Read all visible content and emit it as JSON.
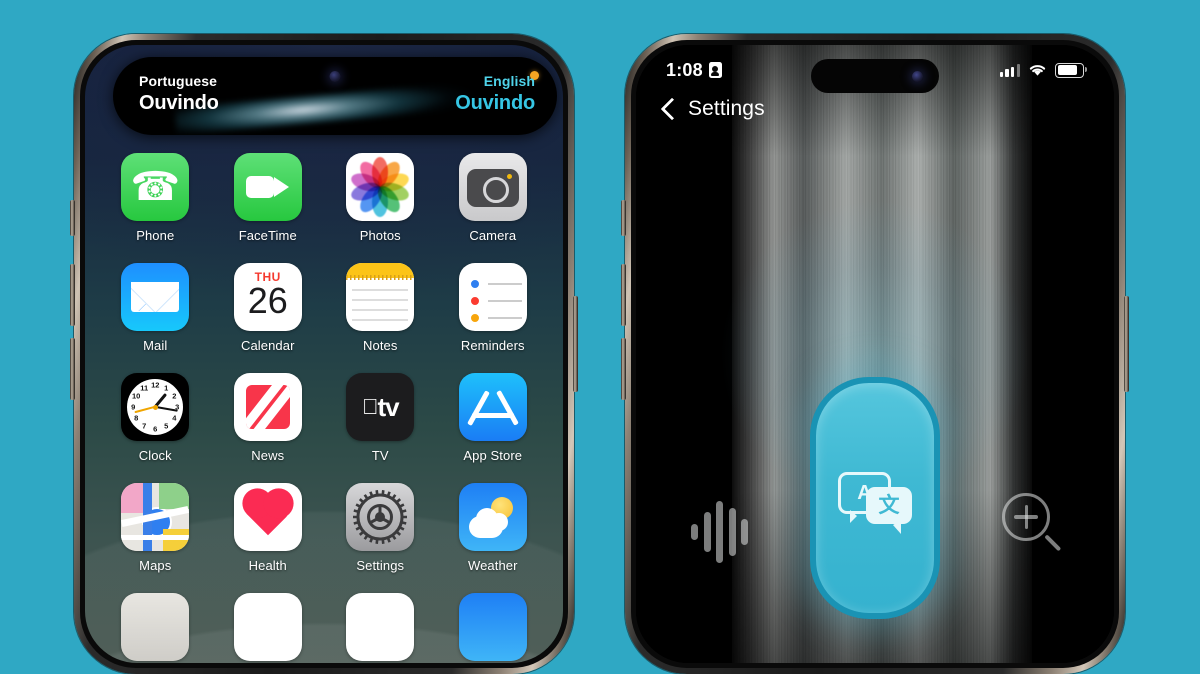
{
  "background_color": "#2FA8C4",
  "left_phone": {
    "name": "iphone-home-screen",
    "dynamic_island": {
      "name": "live-translation-banner",
      "source_language": "Portuguese",
      "source_text": "Ouvindo",
      "target_language": "English",
      "target_text": "Ouvindo",
      "mic_indicator": "orange-dot",
      "source_color": "#ffffff",
      "target_color": "#36c6e4"
    },
    "app_rows": [
      [
        {
          "label": "Phone",
          "icon": "phone-icon"
        },
        {
          "label": "FaceTime",
          "icon": "facetime-icon"
        },
        {
          "label": "Photos",
          "icon": "photos-icon"
        },
        {
          "label": "Camera",
          "icon": "camera-icon"
        }
      ],
      [
        {
          "label": "Mail",
          "icon": "mail-icon"
        },
        {
          "label": "Calendar",
          "icon": "calendar-icon",
          "day_of_week": "THU",
          "day_number": "26"
        },
        {
          "label": "Notes",
          "icon": "notes-icon"
        },
        {
          "label": "Reminders",
          "icon": "reminders-icon"
        }
      ],
      [
        {
          "label": "Clock",
          "icon": "clock-icon"
        },
        {
          "label": "News",
          "icon": "news-icon"
        },
        {
          "label": "TV",
          "icon": "tv-icon",
          "glyph": "tv"
        },
        {
          "label": "App Store",
          "icon": "app-store-icon"
        }
      ],
      [
        {
          "label": "Maps",
          "icon": "maps-icon"
        },
        {
          "label": "Health",
          "icon": "health-icon"
        },
        {
          "label": "Settings",
          "icon": "settings-icon"
        },
        {
          "label": "Weather",
          "icon": "weather-icon"
        }
      ]
    ]
  },
  "right_phone": {
    "name": "action-button-settings-screen",
    "status_bar": {
      "time": "1:08",
      "indicator_icon": "screen-recording-icon",
      "cellular_icon": "signal-bars-icon",
      "wifi_icon": "wifi-icon",
      "battery_icon": "battery-icon"
    },
    "nav": {
      "back_icon": "chevron-left-icon",
      "back_label": "Settings"
    },
    "action_button": {
      "name": "translate-action-button",
      "icon": "translate-icon",
      "bubble_left_glyph": "A",
      "bubble_right_glyph": "文",
      "fill_color": "#3fb9d3",
      "border_color": "#1a93b4"
    },
    "left_control_icon": "sound-waveform-icon",
    "right_control_icon": "magnifier-zoom-in-icon"
  }
}
